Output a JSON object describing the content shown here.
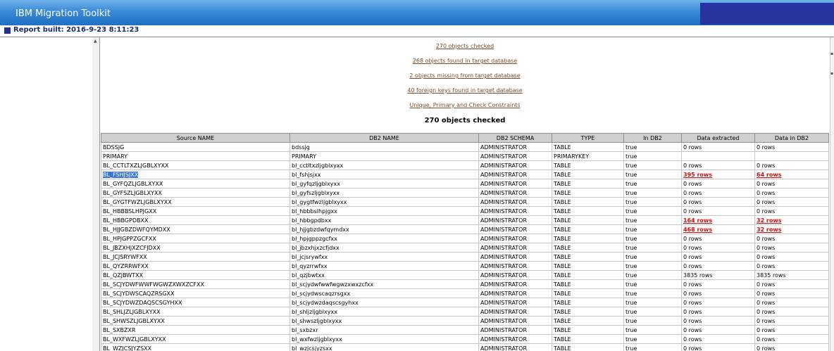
{
  "app": {
    "title": "IBM Migration Toolkit"
  },
  "report": {
    "built": "Report built: 2016-9-23 8:11:23"
  },
  "summary": {
    "links": [
      "270 objects checked",
      "268 objects found in target database",
      "2 objects missing from target database",
      "40 foreign keys found in target database",
      "Unique, Primary and Check Constraints"
    ],
    "heading": "270 objects checked"
  },
  "table": {
    "columns": [
      "Source NAME",
      "DB2 NAME",
      "DB2 SCHEMA",
      "TYPE",
      "In DB2",
      "Data extracted",
      "Data in DB2"
    ],
    "rows": [
      [
        "BDSSJG",
        "bdssjg",
        "ADMINISTRATOR",
        "TABLE",
        "true",
        "0 rows",
        "0 rows"
      ],
      [
        "PRIMARY",
        "PRIMARY",
        "ADMINISTRATOR",
        "PRIMARYKEY",
        "true",
        "",
        ""
      ],
      [
        "BL_CCTLTXZLJGBLXYXX",
        "bl_cctltxzljgblxyxx",
        "ADMINISTRATOR",
        "TABLE",
        "true",
        "0 rows",
        "0 rows"
      ],
      [
        "BL_FSHJSJXX",
        "bl_fshjsjxx",
        "ADMINISTRATOR",
        "TABLE",
        "true",
        "395 rows",
        "64 rows"
      ],
      [
        "BL_GYFQZLJGBLXYXX",
        "bl_gyfqzljgblxyxx",
        "ADMINISTRATOR",
        "TABLE",
        "true",
        "0 rows",
        "0 rows"
      ],
      [
        "BL_GYFSZLJGBLXYXX",
        "bl_gyfszljgblxyxx",
        "ADMINISTRATOR",
        "TABLE",
        "true",
        "0 rows",
        "0 rows"
      ],
      [
        "BL_GYGTFWZLJGBLXYXX",
        "bl_gygtfwzljgblxyxx",
        "ADMINISTRATOR",
        "TABLE",
        "true",
        "0 rows",
        "0 rows"
      ],
      [
        "BL_HBBBSLHPJGXX",
        "bl_hbbbslhpjgxx",
        "ADMINISTRATOR",
        "TABLE",
        "true",
        "0 rows",
        "0 rows"
      ],
      [
        "BL_HBBGPDBXX",
        "bl_hbbgpdbxx",
        "ADMINISTRATOR",
        "TABLE",
        "true",
        "164 rows",
        "32 rows"
      ],
      [
        "BL_HJJGBZDWFQYMDXX",
        "bl_hjjgbzdwfqymdxx",
        "ADMINISTRATOR",
        "TABLE",
        "true",
        "468 rows",
        "32 rows"
      ],
      [
        "BL_HPJGPPZGCFXX",
        "bl_hpjgppzgcfxx",
        "ADMINISTRATOR",
        "TABLE",
        "true",
        "0 rows",
        "0 rows"
      ],
      [
        "BL_JBZXHJXZCFJDXX",
        "bl_jbzxhjxzcfjdxx",
        "ADMINISTRATOR",
        "TABLE",
        "true",
        "0 rows",
        "0 rows"
      ],
      [
        "BL_JCJSRYWFXX",
        "bl_jcjsrywfxx",
        "ADMINISTRATOR",
        "TABLE",
        "true",
        "0 rows",
        "0 rows"
      ],
      [
        "BL_QYZRRWFXX",
        "bl_qyzrrwfxx",
        "ADMINISTRATOR",
        "TABLE",
        "true",
        "0 rows",
        "0 rows"
      ],
      [
        "BL_QZJBWTXX",
        "bl_qzjbwtxx",
        "ADMINISTRATOR",
        "TABLE",
        "true",
        "3835 rows",
        "3835 rows"
      ],
      [
        "BL_SCJYDWFWWFWGWZXWXZCFXX",
        "bl_scjydwfwwfwgwzxwxzcfxx",
        "ADMINISTRATOR",
        "TABLE",
        "true",
        "0 rows",
        "0 rows"
      ],
      [
        "BL_SCJYDWSCAQZRSGXX",
        "bl_scjydwscaqzrsgxx",
        "ADMINISTRATOR",
        "TABLE",
        "true",
        "0 rows",
        "0 rows"
      ],
      [
        "BL_SCJYDWZDAQSCSGYHXX",
        "bl_scjydwzdaqscsgyhxx",
        "ADMINISTRATOR",
        "TABLE",
        "true",
        "0 rows",
        "0 rows"
      ],
      [
        "BL_SHLJZLJGBLXYXX",
        "bl_shljzljgblxyxx",
        "ADMINISTRATOR",
        "TABLE",
        "true",
        "0 rows",
        "0 rows"
      ],
      [
        "BL_SHWSZLJGBLXYXX",
        "bl_shwszljgblxyxx",
        "ADMINISTRATOR",
        "TABLE",
        "true",
        "0 rows",
        "0 rows"
      ],
      [
        "BL_SXBZXR",
        "bl_sxbzxr",
        "ADMINISTRATOR",
        "TABLE",
        "true",
        "0 rows",
        "0 rows"
      ],
      [
        "BL_WXFWZLJGBLXYXX",
        "bl_wxfwzljgblxyxx",
        "ADMINISTRATOR",
        "TABLE",
        "true",
        "0 rows",
        "0 rows"
      ],
      [
        "BL_WZJCSJYZSXX",
        "bl_wzjcsjyzsxx",
        "ADMINISTRATOR",
        "TABLE",
        "true",
        "0 rows",
        "0 rows"
      ]
    ],
    "selected_row": 3,
    "highlight_rows": [
      3,
      8,
      9
    ]
  }
}
